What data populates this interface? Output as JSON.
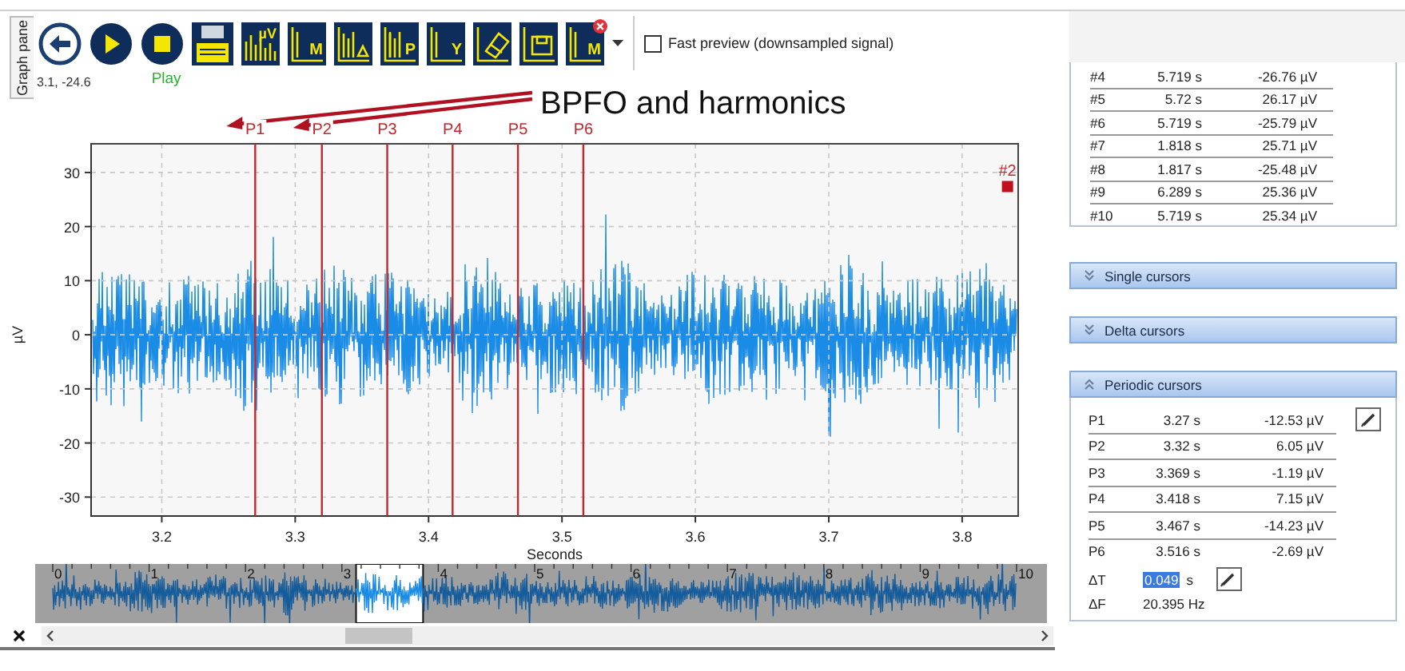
{
  "side_tab": "Graph pane",
  "toolbar": [
    {
      "kind": "back"
    },
    {
      "kind": "play"
    },
    {
      "kind": "stop"
    },
    {
      "kind": "save"
    },
    {
      "kind": "bars",
      "glyph": "µV",
      "badge": false
    },
    {
      "kind": "axis",
      "glyph": "M",
      "badge": false
    },
    {
      "kind": "harmonic",
      "badge": false
    },
    {
      "kind": "axis-bars",
      "glyph": "P",
      "badge": false
    },
    {
      "kind": "axis",
      "glyph": "Y",
      "badge": false
    },
    {
      "kind": "eraser",
      "badge": false
    },
    {
      "kind": "disk",
      "badge": false
    },
    {
      "kind": "axis",
      "glyph": "M",
      "badge": true
    }
  ],
  "fast_preview": {
    "label": "Fast preview (downsampled signal)",
    "checked": false
  },
  "cursor_readout": "3.1, -24.6",
  "play_label": "Play",
  "callout": {
    "text": "BPFO and harmonics"
  },
  "chart_data": {
    "type": "line",
    "xlabel": "Seconds",
    "ylabel": "µV",
    "xlim": [
      3.147,
      3.842
    ],
    "ylim": [
      -33.5,
      35.3
    ],
    "xticks": [
      3.2,
      3.3,
      3.4,
      3.5,
      3.6,
      3.7,
      3.8
    ],
    "yticks": [
      -30,
      -20,
      -10,
      0,
      10,
      20,
      30
    ],
    "grid": true,
    "ref_lines": [
      {
        "axis": "x",
        "value": 3.27,
        "label": "P1"
      },
      {
        "axis": "x",
        "value": 3.32,
        "label": "P2"
      },
      {
        "axis": "x",
        "value": 3.369,
        "label": "P3"
      },
      {
        "axis": "x",
        "value": 3.418,
        "label": "P4"
      },
      {
        "axis": "x",
        "value": 3.467,
        "label": "P5"
      },
      {
        "axis": "x",
        "value": 3.516,
        "label": "P6"
      }
    ],
    "annotations": [
      {
        "text": "#2",
        "x": 3.834,
        "y": 27.4
      }
    ]
  },
  "overview": {
    "ticks": [
      "0",
      "1",
      "2",
      "3",
      "4",
      "5",
      "6",
      "7",
      "8",
      "9",
      "10"
    ]
  },
  "peaks": [
    {
      "id": "#4",
      "time": "5.719 s",
      "value": "-26.76 µV"
    },
    {
      "id": "#5",
      "time": "5.72 s",
      "value": "26.17 µV"
    },
    {
      "id": "#6",
      "time": "5.719 s",
      "value": "-25.79 µV"
    },
    {
      "id": "#7",
      "time": "1.818 s",
      "value": "25.71 µV"
    },
    {
      "id": "#8",
      "time": "1.817 s",
      "value": "-25.48 µV"
    },
    {
      "id": "#9",
      "time": "6.289 s",
      "value": "25.36 µV"
    },
    {
      "id": "#10",
      "time": "5.719 s",
      "value": "25.34 µV"
    }
  ],
  "sections": [
    {
      "title": "Single cursors",
      "expanded": false
    },
    {
      "title": "Delta cursors",
      "expanded": false
    },
    {
      "title": "Periodic cursors",
      "expanded": true,
      "rows": [
        {
          "name": "P1",
          "time": "3.27 s",
          "value": "-12.53 µV"
        },
        {
          "name": "P2",
          "time": "3.32 s",
          "value": "6.05 µV"
        },
        {
          "name": "P3",
          "time": "3.369 s",
          "value": "-1.19 µV"
        },
        {
          "name": "P4",
          "time": "3.418 s",
          "value": "7.15 µV"
        },
        {
          "name": "P5",
          "time": "3.467 s",
          "value": "-14.23 µV"
        },
        {
          "name": "P6",
          "time": "3.516 s",
          "value": "-2.69 µV"
        }
      ],
      "delta": {
        "dt_label": "ΔT",
        "dt_value": "0.049",
        "dt_unit": "s",
        "df_label": "ΔF",
        "df_value": "20.395 Hz"
      }
    }
  ]
}
